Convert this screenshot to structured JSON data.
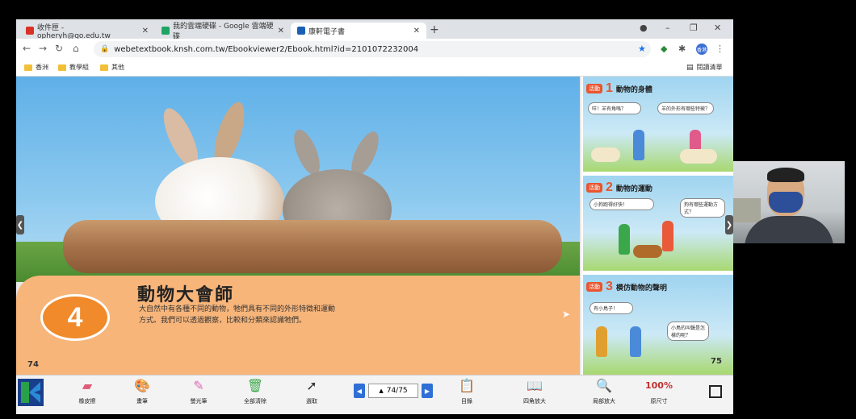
{
  "browser": {
    "tabs": [
      {
        "title": "收件匣 - opheryh@go.edu.tw",
        "favicon_color": "#d93025"
      },
      {
        "title": "我的雲端硬碟 - Google 雲端硬碟",
        "favicon_color": "#1fa463"
      },
      {
        "title": "康軒電子書",
        "favicon_color": "#1a5fb4"
      }
    ],
    "url": "webetextbook.knsh.com.tw/Ebookviewer2/Ebook.html?id=2101072232004",
    "bookmarks": [
      "香洲",
      "教學組",
      "其他"
    ],
    "reading_list": "閱讀清單",
    "profile_initials": "香港"
  },
  "ebook": {
    "lesson_number": "4",
    "lesson_title": "動物大會師",
    "lesson_text": "大自然中有各種不同的動物，牠們具有不同的外形特徵和運動方式。我們可以透過觀察，比較和分類來認識牠們。",
    "page_left": "74",
    "page_right": "75",
    "activities": [
      {
        "tag": "活動",
        "num": "1",
        "title": "動物的身體",
        "bubble1": "咩！羊有角嗎？",
        "bubble2": "羊的外形有哪些特徵？"
      },
      {
        "tag": "活動",
        "num": "2",
        "title": "動物的運動",
        "bubble1": "小狗跑得好快！",
        "bubble2": "狗有哪些運動方式？"
      },
      {
        "tag": "活動",
        "num": "3",
        "title": "模仿動物的聲明",
        "bubble1": "有小鳥子！",
        "bubble2": "小鳥的叫聲是怎樣的呢？"
      }
    ]
  },
  "toolbar": {
    "tools": [
      {
        "label": "橡皮擦",
        "icon": "eraser-icon",
        "color": "#e05a7a"
      },
      {
        "label": "畫筆",
        "icon": "palette-icon",
        "color": "#c07a3a"
      },
      {
        "label": "螢光筆",
        "icon": "highlighter-icon",
        "color": "#e06ab8"
      },
      {
        "label": "全部清除",
        "icon": "trash-icon",
        "color": "#3aa84a"
      },
      {
        "label": "選取",
        "icon": "cursor-icon",
        "color": "#333333"
      }
    ],
    "page_indicator": "74/75",
    "right_tools": [
      {
        "label": "目錄",
        "icon": "toc-icon",
        "color": "#e07a2a"
      },
      {
        "label": "四角放大",
        "icon": "book-icon",
        "color": "#c04040"
      },
      {
        "label": "局部放大",
        "icon": "zoom-icon",
        "color": "#5a5a9a"
      },
      {
        "label": "原尺寸",
        "icon": "actual-size-icon",
        "color": "#c03030",
        "text": "100%"
      }
    ]
  }
}
